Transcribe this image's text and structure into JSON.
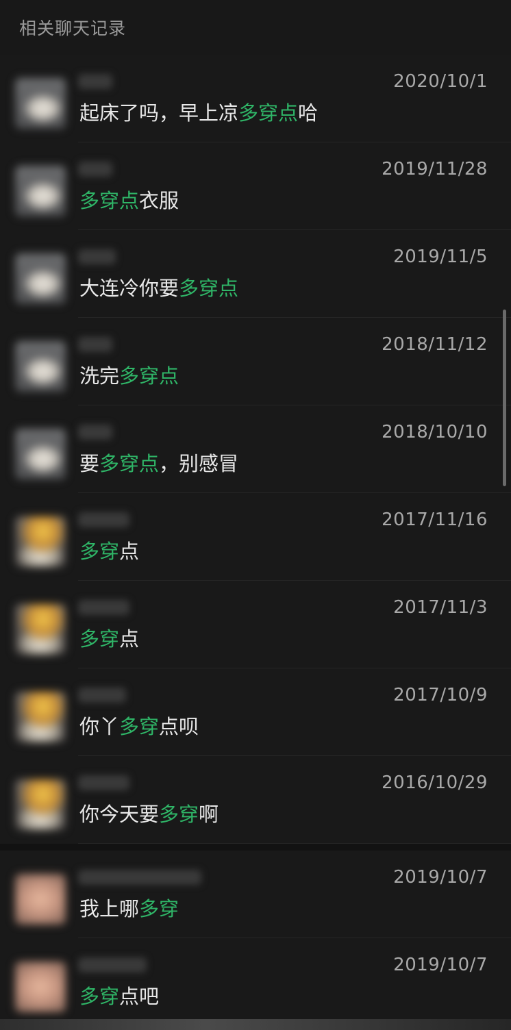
{
  "header": {
    "title": "相关聊天记录"
  },
  "groups": [
    {
      "items": [
        {
          "date": "2020/10/1",
          "avatar": "cloud",
          "segments": [
            {
              "t": "起床了吗，早上凉",
              "h": false
            },
            {
              "t": "多穿点",
              "h": true
            },
            {
              "t": "哈",
              "h": false
            }
          ]
        },
        {
          "date": "2019/11/28",
          "avatar": "cloud",
          "segments": [
            {
              "t": "多穿点",
              "h": true
            },
            {
              "t": "衣服",
              "h": false
            }
          ]
        },
        {
          "date": "2019/11/5",
          "avatar": "cloud",
          "segments": [
            {
              "t": "大连冷你要",
              "h": false
            },
            {
              "t": "多穿点",
              "h": true
            }
          ]
        },
        {
          "date": "2018/11/12",
          "avatar": "cloud",
          "segments": [
            {
              "t": "洗完",
              "h": false
            },
            {
              "t": "多穿点",
              "h": true
            }
          ]
        },
        {
          "date": "2018/10/10",
          "avatar": "cloud",
          "segments": [
            {
              "t": "要",
              "h": false
            },
            {
              "t": "多穿点",
              "h": true
            },
            {
              "t": "，别感冒",
              "h": false
            }
          ]
        },
        {
          "date": "2017/11/16",
          "avatar": "sunset",
          "segments": [
            {
              "t": "多穿",
              "h": true
            },
            {
              "t": "点",
              "h": false
            }
          ]
        },
        {
          "date": "2017/11/3",
          "avatar": "sunset",
          "segments": [
            {
              "t": "多穿",
              "h": true
            },
            {
              "t": "点",
              "h": false
            }
          ]
        },
        {
          "date": "2017/10/9",
          "avatar": "sunset",
          "segments": [
            {
              "t": "你丫",
              "h": false
            },
            {
              "t": "多穿",
              "h": true
            },
            {
              "t": "点呗",
              "h": false
            }
          ]
        },
        {
          "date": "2016/10/29",
          "avatar": "sunset",
          "segments": [
            {
              "t": "你今天要",
              "h": false
            },
            {
              "t": "多穿",
              "h": true
            },
            {
              "t": "啊",
              "h": false
            }
          ]
        }
      ]
    },
    {
      "items": [
        {
          "date": "2019/10/7",
          "avatar": "skin",
          "segments": [
            {
              "t": "我上哪",
              "h": false
            },
            {
              "t": "多穿",
              "h": true
            }
          ]
        },
        {
          "date": "2019/10/7",
          "avatar": "skin",
          "segments": [
            {
              "t": "多穿",
              "h": true
            },
            {
              "t": "点吧",
              "h": false
            }
          ]
        }
      ]
    }
  ],
  "colors": {
    "background": "#191919",
    "highlight": "#2fb567",
    "date": "#a9a9a9",
    "text": "#e8e8e8"
  }
}
